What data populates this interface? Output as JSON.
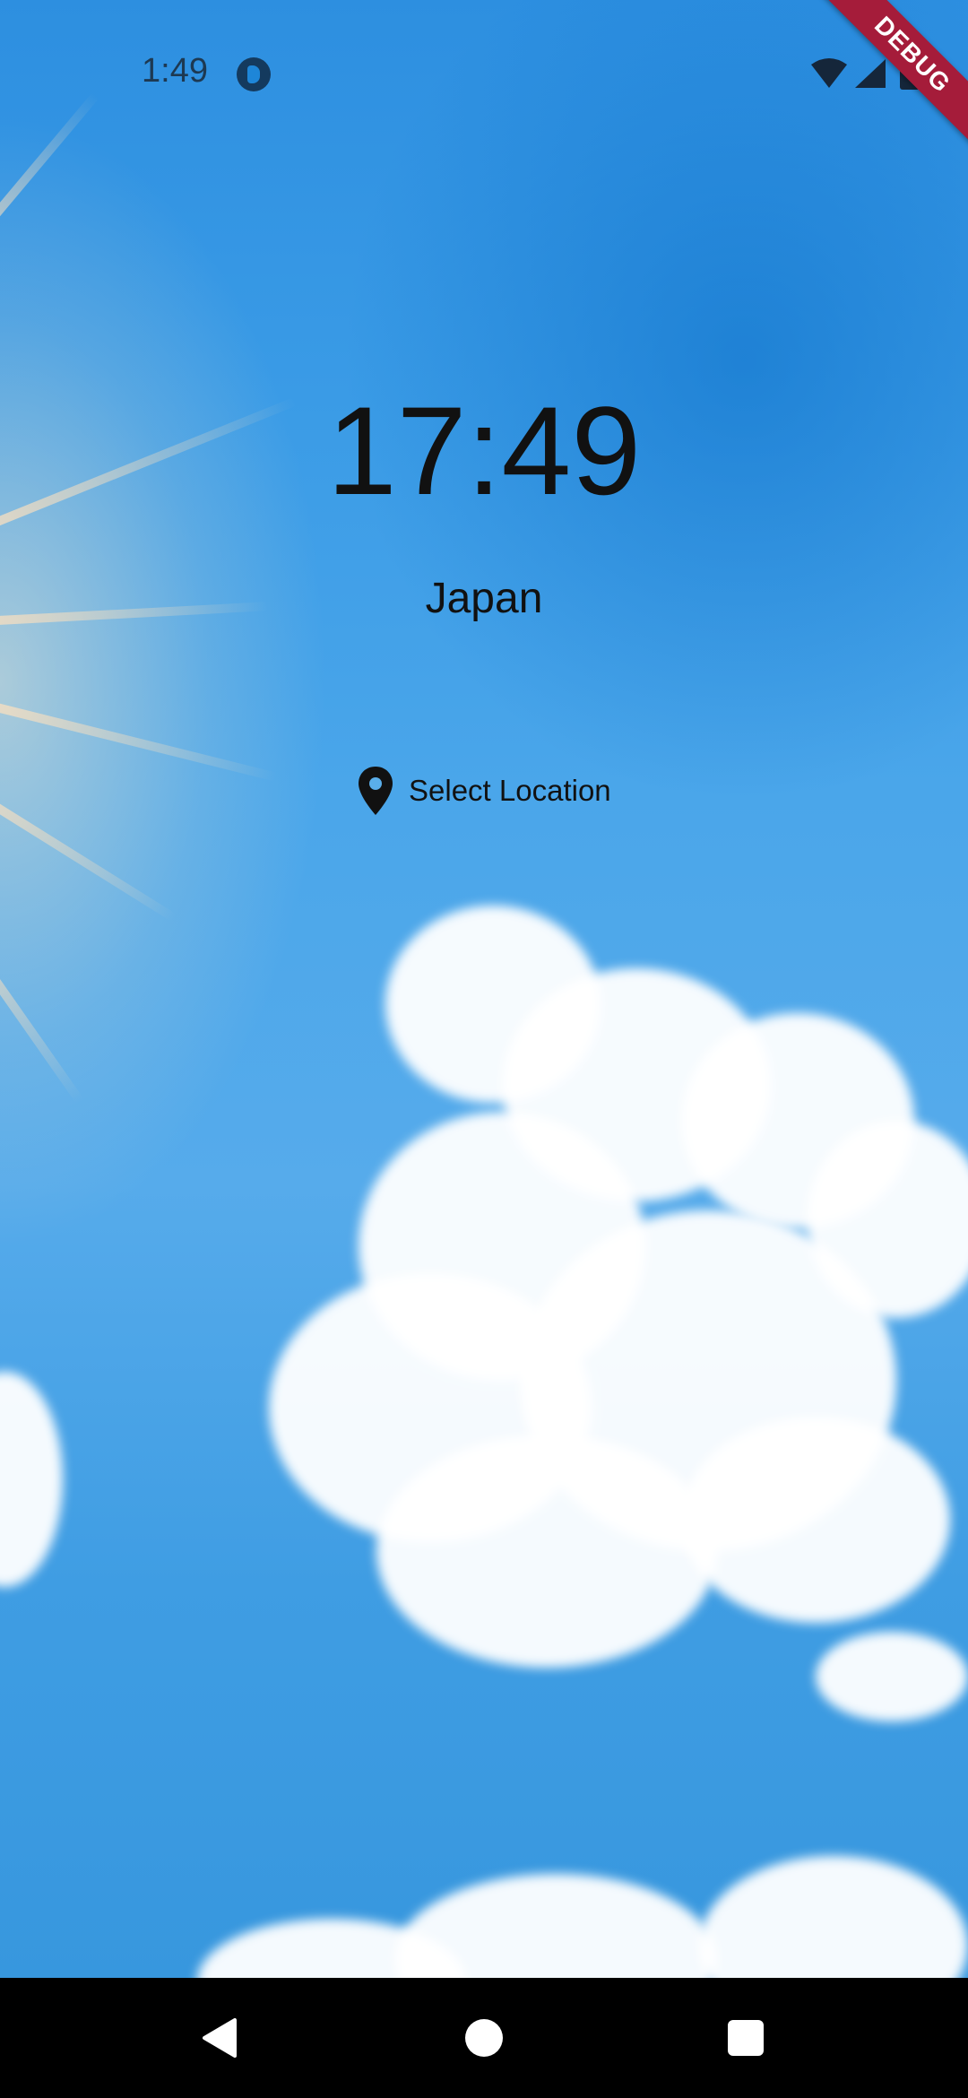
{
  "status_bar": {
    "time": "1:49",
    "debug_label": "DEBUG",
    "icons": [
      "app-notification-icon",
      "wifi-icon",
      "signal-icon",
      "battery-icon"
    ]
  },
  "main": {
    "clock": "17:49",
    "location_name": "Japan",
    "select_location_label": "Select Location",
    "select_location_icon": "location-pin-icon"
  },
  "nav_bar": {
    "icons": [
      "back-icon",
      "home-icon",
      "recents-icon"
    ]
  },
  "colors": {
    "sky": "#3a9be6",
    "text": "#111111",
    "debug_banner": "#a51c3a",
    "nav_bar": "#000000"
  }
}
